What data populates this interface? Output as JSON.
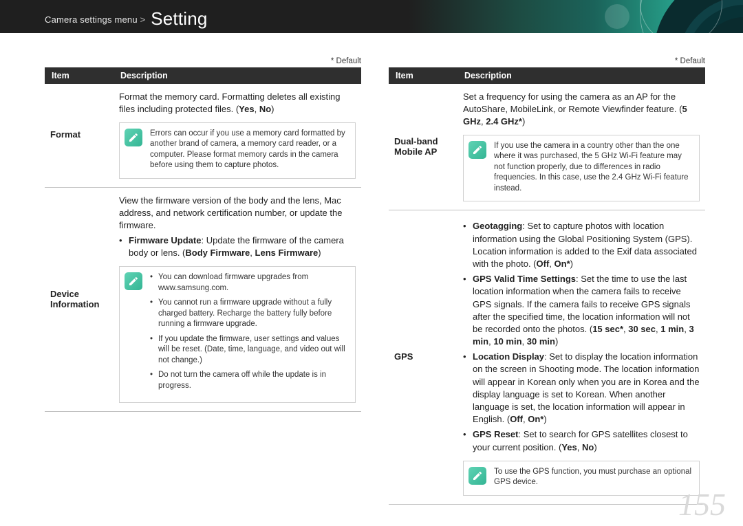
{
  "header": {
    "breadcrumb": "Camera settings menu",
    "sep": ">",
    "title": "Setting"
  },
  "default_label": "* Default",
  "table_head": {
    "item": "Item",
    "description": "Description"
  },
  "left": {
    "rows": [
      {
        "item": "Format",
        "paragraphs": [
          "Format the memory card. Formatting deletes all existing files including protected files. (<b>Yes</b>, <b>No</b>)"
        ],
        "info": {
          "type": "plain",
          "text": "Errors can occur if you use a memory card formatted by another brand of camera, a memory card reader, or a computer. Please format memory cards in the camera before using them to capture photos."
        }
      },
      {
        "item": "Device Information",
        "paragraphs": [
          "View the firmware version of the body and the lens, Mac address, and network certification number, or update the firmware."
        ],
        "bullets": [
          "<b>Firmware Update</b>: Update the firmware of the camera body or lens. (<b>Body Firmware</b>, <b>Lens Firmware</b>)"
        ],
        "info": {
          "type": "list",
          "items": [
            "You can download firmware upgrades from www.samsung.com.",
            "You cannot run a firmware upgrade without a fully charged battery. Recharge the battery fully before running a firmware upgrade.",
            "If you update the firmware, user settings and values will be reset. (Date, time, language, and video out will not change.)",
            "Do not turn the camera off while the update is in progress."
          ]
        }
      }
    ]
  },
  "right": {
    "rows": [
      {
        "item": "Dual-band Mobile AP",
        "paragraphs": [
          "Set a frequency for using the camera as an AP for the AutoShare, MobileLink, or Remote Viewfinder feature. (<b>5 GHz</b>, <b>2.4 GHz*</b>)"
        ],
        "info": {
          "type": "plain",
          "text": "If you use the camera in a country other than the one where it was purchased, the 5 GHz Wi-Fi feature may not function properly, due to differences in radio frequencies. In this case, use the 2.4 GHz Wi-Fi feature instead."
        }
      },
      {
        "item": "GPS",
        "bullets": [
          "<b>Geotagging</b>: Set to capture photos with location information using the Global Positioning System (GPS). Location information is added to the Exif data associated with the photo. (<b>Off</b>, <b>On*</b>)",
          "<b>GPS Valid Time Settings</b>: Set the time to use the last location information when the camera fails to receive GPS signals. If the camera fails to receive GPS signals after the specified time, the location information will not be recorded onto the photos. (<b>15 sec*</b>, <b>30 sec</b>, <b>1 min</b>, <b>3 min</b>, <b>10 min</b>, <b>30 min</b>)",
          "<b>Location Display</b>: Set to display the location information on the screen in Shooting mode. The location information will appear in Korean only when you are in Korea and the display language is set to Korean. When another language is set, the location information will appear in English. (<b>Off</b>, <b>On*</b>)",
          "<b>GPS Reset</b>: Set to search for GPS satellites closest to your current position. (<b>Yes</b>, <b>No</b>)"
        ],
        "info": {
          "type": "plain",
          "text": "To use the GPS function, you must purchase an optional GPS device."
        }
      }
    ]
  },
  "page_number": "155"
}
